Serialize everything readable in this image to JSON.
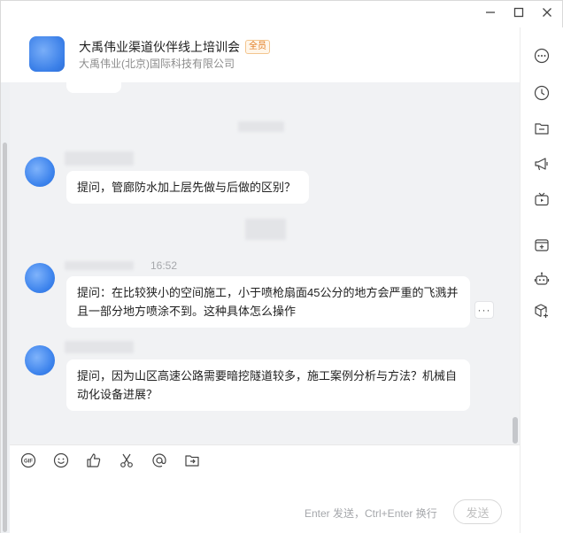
{
  "window": {
    "controls": [
      "minimize-icon",
      "maximize-icon",
      "close-icon"
    ]
  },
  "header": {
    "title": "大禹伟业渠道伙伴线上培训会",
    "badge": "全员",
    "subtitle": "大禹伟业(北京)国际科技有限公司"
  },
  "messages": [
    {
      "time": "",
      "text": "提问，管廊防水加上层先做与后做的区别？"
    },
    {
      "time": "16:52",
      "text": "提问：在比较狭小的空间施工，小于喷枪扇面45公分的地方会严重的飞溅并且一部分地方喷涂不到。这种具体怎么操作"
    },
    {
      "time": "",
      "text": "提问，因为山区高速公路需要暗挖隧道较多，施工案例分析与方法？机械自动化设备进展？"
    }
  ],
  "message_actions": {
    "more": "···"
  },
  "input": {
    "toolbar": [
      "gif-icon",
      "emoji-icon",
      "thumbs-up-icon",
      "scissors-icon",
      "at-icon",
      "folder-send-icon"
    ],
    "hint": "Enter 发送，Ctrl+Enter 换行",
    "send_label": "发送"
  },
  "sidebar": [
    "more-icon",
    "history-icon",
    "folder-icon",
    "announcement-icon",
    "live-tv-icon",
    "add-app-icon",
    "robot-icon",
    "cube-add-icon"
  ],
  "colors": {
    "accent": "#3b82ec",
    "badge": "#e07a1f",
    "chat_bg": "#f1f2f4"
  }
}
